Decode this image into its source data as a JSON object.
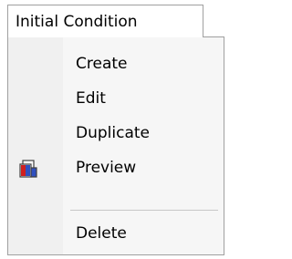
{
  "menu": {
    "title": "Initial Condition",
    "items": [
      {
        "label": "Create"
      },
      {
        "label": "Edit"
      },
      {
        "label": "Duplicate"
      },
      {
        "label": "Preview",
        "icon": "preview-icon"
      },
      {
        "label": "Delete"
      }
    ]
  },
  "colors": {
    "dropdown_background": "#f0f0f0",
    "border": "#a0a0a0",
    "icon_red": "#d02020",
    "icon_blue": "#3050c0"
  }
}
